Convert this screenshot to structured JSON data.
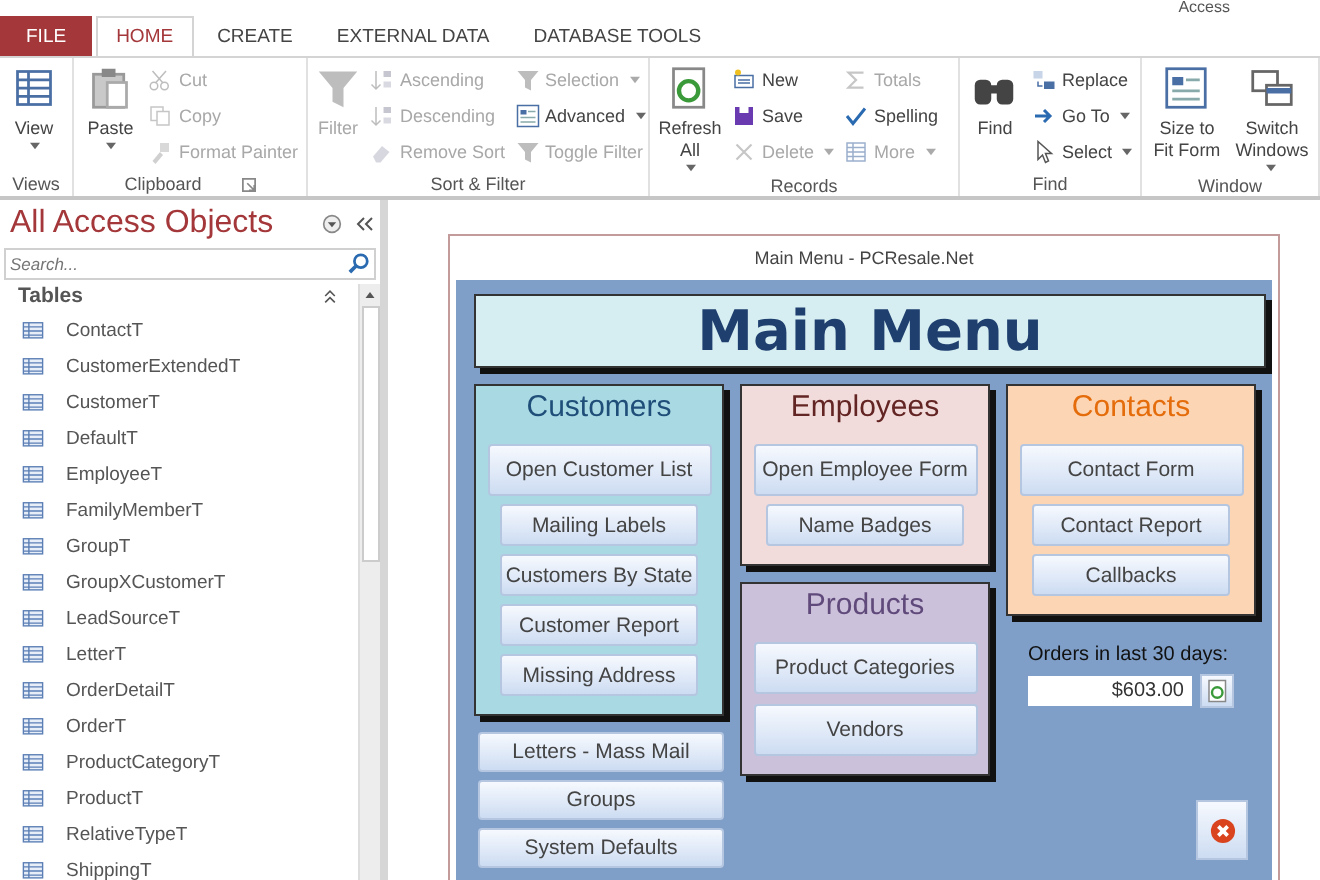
{
  "window": {
    "title": "Access"
  },
  "ribbon": {
    "tabs": [
      {
        "label": "FILE",
        "kind": "file",
        "selected": false
      },
      {
        "label": "HOME",
        "kind": "tab",
        "selected": true
      },
      {
        "label": "CREATE",
        "kind": "tab",
        "selected": false
      },
      {
        "label": "EXTERNAL DATA",
        "kind": "tab",
        "selected": false
      },
      {
        "label": "DATABASE TOOLS",
        "kind": "tab",
        "selected": false
      }
    ],
    "groups": [
      {
        "label": "Views",
        "columns": [
          {
            "kind": "large",
            "label": "View",
            "disabled": false,
            "dropdown": true
          }
        ]
      },
      {
        "label": "Clipboard",
        "launcher": true,
        "columns": [
          {
            "kind": "large",
            "label": "Paste",
            "disabled": false,
            "dropdown": true
          },
          {
            "kind": "stack",
            "items": [
              {
                "label": "Cut",
                "disabled": true,
                "dropdown": false
              },
              {
                "label": "Copy",
                "disabled": true,
                "dropdown": false
              },
              {
                "label": "Format Painter",
                "disabled": true,
                "dropdown": false
              }
            ]
          }
        ]
      },
      {
        "label": "Sort & Filter",
        "columns": [
          {
            "kind": "large",
            "label": "Filter",
            "disabled": true,
            "dropdown": false
          },
          {
            "kind": "stack",
            "items": [
              {
                "label": "Ascending",
                "disabled": true,
                "dropdown": false
              },
              {
                "label": "Descending",
                "disabled": true,
                "dropdown": false
              },
              {
                "label": "Remove Sort",
                "disabled": true,
                "dropdown": false
              }
            ]
          },
          {
            "kind": "stack",
            "items": [
              {
                "label": "Selection",
                "disabled": true,
                "dropdown": true
              },
              {
                "label": "Advanced",
                "disabled": false,
                "dropdown": true
              },
              {
                "label": "Toggle Filter",
                "disabled": true,
                "dropdown": false
              }
            ]
          }
        ]
      },
      {
        "label": "Records",
        "columns": [
          {
            "kind": "large",
            "label": "Refresh All",
            "disabled": false,
            "dropdown": true
          },
          {
            "kind": "stack",
            "items": [
              {
                "label": "New",
                "disabled": false,
                "dropdown": false
              },
              {
                "label": "Save",
                "disabled": false,
                "dropdown": false
              },
              {
                "label": "Delete",
                "disabled": true,
                "dropdown": true
              }
            ]
          },
          {
            "kind": "stack",
            "items": [
              {
                "label": "Totals",
                "disabled": true,
                "dropdown": false
              },
              {
                "label": "Spelling",
                "disabled": false,
                "dropdown": false
              },
              {
                "label": "More",
                "disabled": true,
                "dropdown": true
              }
            ]
          }
        ]
      },
      {
        "label": "Find",
        "columns": [
          {
            "kind": "large",
            "label": "Find",
            "disabled": false,
            "dropdown": false
          },
          {
            "kind": "stack",
            "items": [
              {
                "label": "Replace",
                "disabled": false,
                "dropdown": false
              },
              {
                "label": "Go To",
                "disabled": false,
                "dropdown": true
              },
              {
                "label": "Select",
                "disabled": false,
                "dropdown": true
              }
            ]
          }
        ]
      },
      {
        "label": "Window",
        "columns": [
          {
            "kind": "large",
            "label": "Size to Fit Form",
            "disabled": false,
            "dropdown": false
          },
          {
            "kind": "large",
            "label": "Switch Windows",
            "disabled": false,
            "dropdown": true
          }
        ]
      }
    ]
  },
  "navigation": {
    "title": "All Access Objects",
    "search": {
      "placeholder": "Search..."
    },
    "sections": [
      {
        "label": "Tables",
        "expanded": true,
        "items": [
          "ContactT",
          "CustomerExtendedT",
          "CustomerT",
          "DefaultT",
          "EmployeeT",
          "FamilyMemberT",
          "GroupT",
          "GroupXCustomerT",
          "LeadSourceT",
          "LetterT",
          "OrderDetailT",
          "OrderT",
          "ProductCategoryT",
          "ProductT",
          "RelativeTypeT",
          "ShippingT"
        ]
      }
    ]
  },
  "form": {
    "title": "Main Menu - PCResale.Net",
    "heading": "Main Menu",
    "columns": [
      {
        "panels": [
          {
            "title": "Customers",
            "color": "#a9d9e3",
            "buttons": [
              {
                "label": "Open Customer List",
                "kind": "large"
              },
              {
                "label": "Mailing Labels",
                "kind": "small"
              },
              {
                "label": "Customers By State",
                "kind": "small"
              },
              {
                "label": "Customer Report",
                "kind": "small"
              },
              {
                "label": "Missing Address",
                "kind": "small"
              }
            ]
          }
        ],
        "buttons": [
          "Letters - Mass Mail",
          "Groups",
          "System Defaults"
        ]
      },
      {
        "panels": [
          {
            "title": "Employees",
            "color": "#f2dcdb",
            "buttons": [
              {
                "label": "Open Employee Form",
                "kind": "large"
              },
              {
                "label": "Name Badges",
                "kind": "small"
              }
            ]
          },
          {
            "title": "Products",
            "color": "#ccc1da",
            "buttons": [
              {
                "label": "Product Categories",
                "kind": "large"
              },
              {
                "label": "Vendors",
                "kind": "large"
              }
            ]
          }
        ]
      },
      {
        "panels": [
          {
            "title": "Contacts",
            "color": "#fcd5b5",
            "buttons": [
              {
                "label": "Contact Form",
                "kind": "large"
              },
              {
                "label": "Contact Report",
                "kind": "small"
              },
              {
                "label": "Callbacks",
                "kind": "small"
              }
            ]
          }
        ],
        "orders": {
          "label": "Orders in last 30 days:",
          "value": "$603.00"
        }
      }
    ]
  }
}
